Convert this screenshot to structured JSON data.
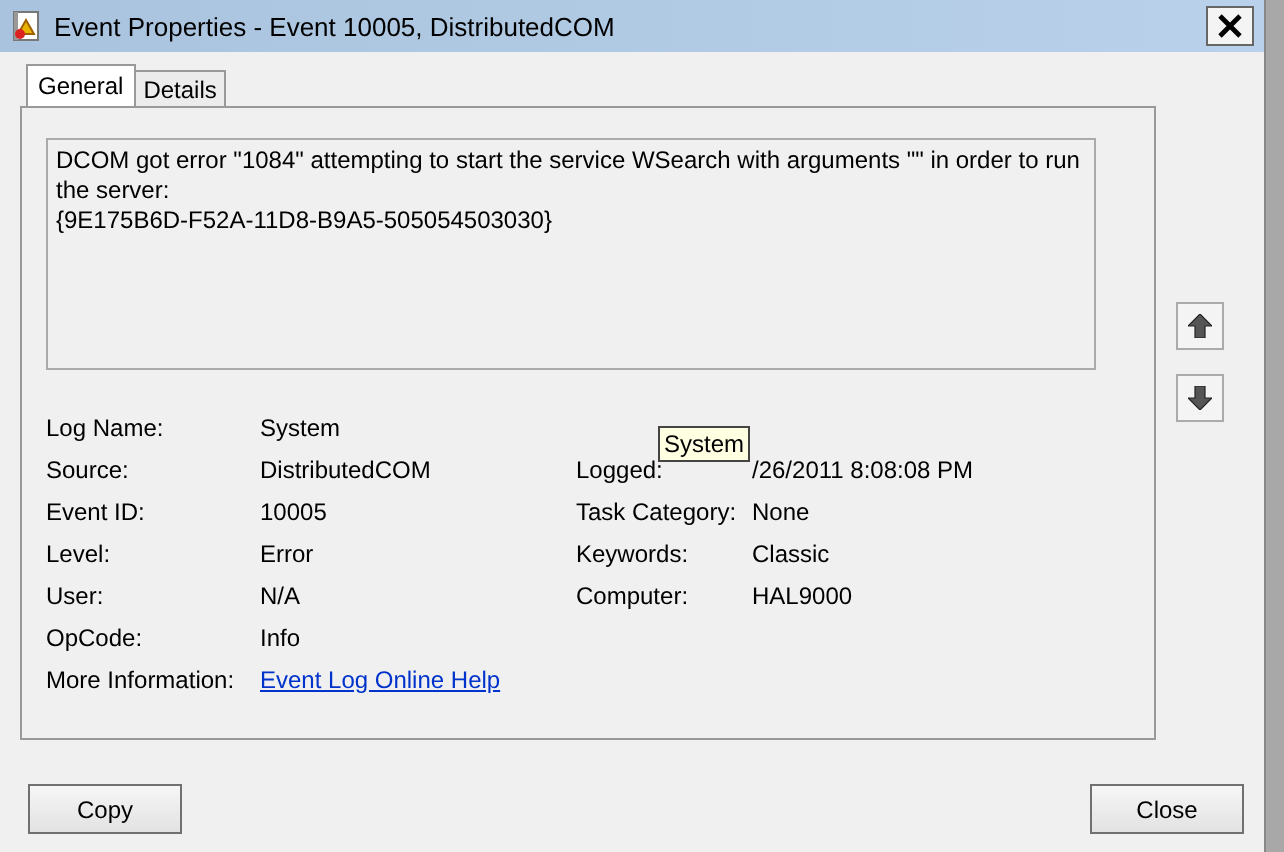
{
  "window": {
    "title": "Event Properties - Event 10005, DistributedCOM"
  },
  "tabs": [
    {
      "label": "General",
      "selected": true
    },
    {
      "label": "Details",
      "selected": false
    }
  ],
  "message": "DCOM got error \"1084\" attempting to start the service WSearch with arguments \"\" in order to run the server:\n{9E175B6D-F52A-11D8-B9A5-505054503030}",
  "details_left": [
    {
      "label": "Log Name:",
      "value": "System",
      "kind": "text"
    },
    {
      "label": "Source:",
      "value": "DistributedCOM",
      "kind": "text"
    },
    {
      "label": "Event ID:",
      "value": "10005",
      "kind": "text"
    },
    {
      "label": "Level:",
      "value": "Error",
      "kind": "text"
    },
    {
      "label": "User:",
      "value": "N/A",
      "kind": "text"
    },
    {
      "label": "OpCode:",
      "value": "Info",
      "kind": "text"
    },
    {
      "label": "More Information:",
      "value": "Event Log Online Help",
      "kind": "link"
    }
  ],
  "details_right": [
    {
      "label": "Logged:",
      "value": "/26/2011 8:08:08 PM",
      "tooltip": "System"
    },
    {
      "label": "Task Category:",
      "value": "None"
    },
    {
      "label": "Keywords:",
      "value": "Classic"
    },
    {
      "label": "Computer:",
      "value": "HAL9000"
    }
  ],
  "buttons": [
    "Copy",
    "Close"
  ]
}
